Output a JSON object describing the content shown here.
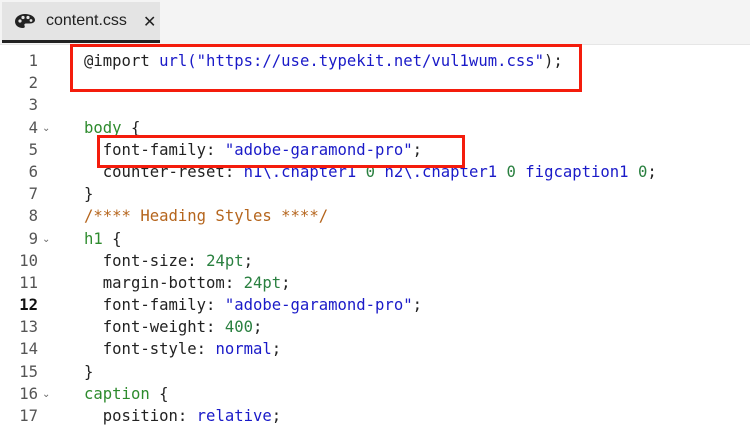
{
  "tab": {
    "filename": "content.css",
    "icon": "palette-icon",
    "close_icon": "close-icon"
  },
  "current_line": 12,
  "lines": [
    {
      "n": "1",
      "fold": false,
      "tokens": [
        [
          "@import ",
          "kw"
        ],
        [
          "url(",
          "fn"
        ],
        [
          "\"https://use.typekit.net/vul1wum.css\"",
          "str"
        ],
        [
          ");",
          "kw"
        ]
      ]
    },
    {
      "n": "2",
      "fold": false,
      "tokens": []
    },
    {
      "n": "3",
      "fold": false,
      "tokens": []
    },
    {
      "n": "4",
      "fold": true,
      "tokens": [
        [
          "body",
          "sel"
        ],
        [
          " {",
          "kw"
        ]
      ]
    },
    {
      "n": "5",
      "fold": false,
      "tokens": [
        [
          "  font-family: ",
          "prop"
        ],
        [
          "\"adobe-garamond-pro\"",
          "str"
        ],
        [
          ";",
          "kw"
        ]
      ]
    },
    {
      "n": "6",
      "fold": false,
      "tokens": [
        [
          "  counter-reset: ",
          "prop"
        ],
        [
          "h1\\.chapter1 ",
          "str"
        ],
        [
          "0 ",
          "num"
        ],
        [
          "h2\\.chapter1 ",
          "str"
        ],
        [
          "0 ",
          "num"
        ],
        [
          "figcaption1 ",
          "str"
        ],
        [
          "0",
          "num"
        ],
        [
          ";",
          "kw"
        ]
      ]
    },
    {
      "n": "7",
      "fold": false,
      "tokens": [
        [
          "}",
          "kw"
        ]
      ]
    },
    {
      "n": "8",
      "fold": false,
      "tokens": [
        [
          "/**** Heading Styles ****/",
          "cmt"
        ]
      ]
    },
    {
      "n": "9",
      "fold": true,
      "tokens": [
        [
          "h1",
          "sel"
        ],
        [
          " {",
          "kw"
        ]
      ]
    },
    {
      "n": "10",
      "fold": false,
      "tokens": [
        [
          "  font-size: ",
          "prop"
        ],
        [
          "24pt",
          "num"
        ],
        [
          ";",
          "kw"
        ]
      ]
    },
    {
      "n": "11",
      "fold": false,
      "tokens": [
        [
          "  margin-bottom: ",
          "prop"
        ],
        [
          "24pt",
          "num"
        ],
        [
          ";",
          "kw"
        ]
      ]
    },
    {
      "n": "12",
      "fold": false,
      "tokens": [
        [
          "  font-family: ",
          "prop"
        ],
        [
          "\"adobe-garamond-pro\"",
          "str"
        ],
        [
          ";",
          "kw"
        ]
      ]
    },
    {
      "n": "13",
      "fold": false,
      "tokens": [
        [
          "  font-weight: ",
          "prop"
        ],
        [
          "400",
          "num"
        ],
        [
          ";",
          "kw"
        ]
      ]
    },
    {
      "n": "14",
      "fold": false,
      "tokens": [
        [
          "  font-style: ",
          "prop"
        ],
        [
          "normal",
          "str"
        ],
        [
          ";",
          "kw"
        ]
      ]
    },
    {
      "n": "15",
      "fold": false,
      "tokens": [
        [
          "}",
          "kw"
        ]
      ]
    },
    {
      "n": "16",
      "fold": true,
      "tokens": [
        [
          "caption",
          "sel"
        ],
        [
          " {",
          "kw"
        ]
      ]
    },
    {
      "n": "17",
      "fold": false,
      "tokens": [
        [
          "  position: ",
          "prop"
        ],
        [
          "relative",
          "str"
        ],
        [
          ";",
          "kw"
        ]
      ]
    }
  ],
  "highlight_color": "#f41c0c"
}
